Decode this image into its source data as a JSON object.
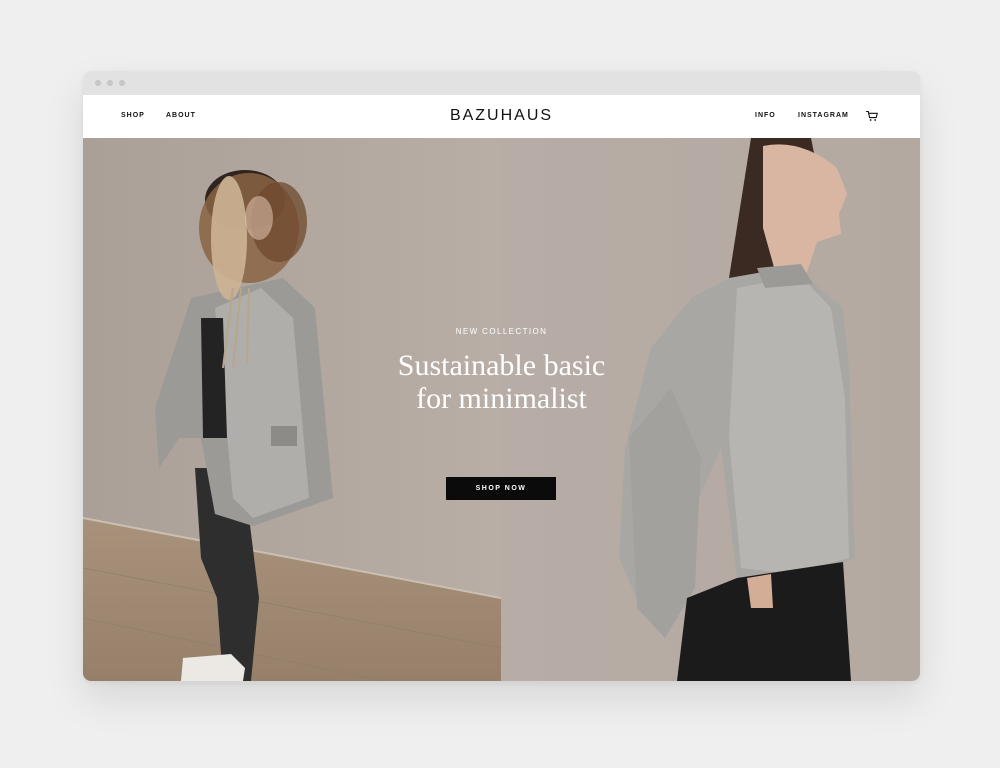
{
  "nav": {
    "left_links": [
      "SHOP",
      "ABOUT"
    ],
    "brand": "BAZUHAUS",
    "right_links": [
      "INFO",
      "INSTAGRAM"
    ],
    "cart_icon": "cart-icon"
  },
  "hero": {
    "eyebrow": "NEW COLLECTION",
    "headline_line1": "Sustainable basic",
    "headline_line2": "for minimalist",
    "cta_label": "SHOP NOW"
  },
  "colors": {
    "background": "#efefef",
    "chrome": "#e2e2e2",
    "wall_left": "#b6aca3",
    "wall_right": "#b8aea7",
    "floor": "#9e8a74",
    "cta_bg": "#0b0b0b",
    "text_light": "#ffffff"
  }
}
